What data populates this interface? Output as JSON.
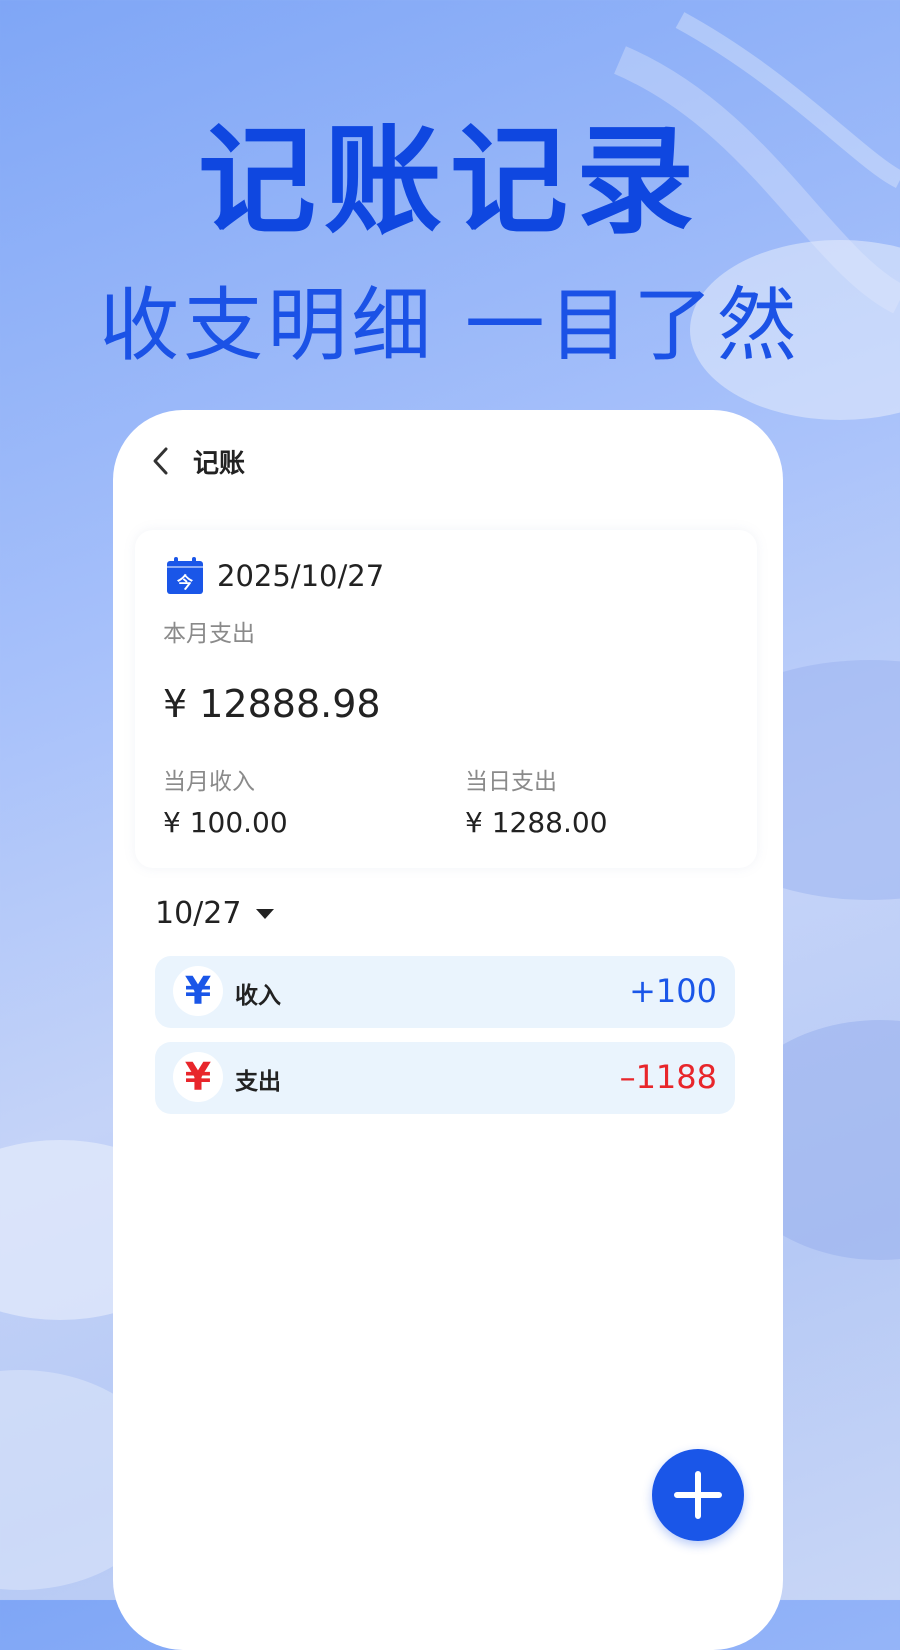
{
  "hero": {
    "title": "记账记录",
    "subtitle": "收支明细 一目了然"
  },
  "nav": {
    "title": "记账"
  },
  "summary": {
    "date": "2025/10/27",
    "calendar_glyph": "今",
    "month_expense_label": "本月支出",
    "month_expense_value": "¥ 12888.98",
    "month_income_label": "当月收入",
    "month_income_value": "¥ 100.00",
    "day_expense_label": "当日支出",
    "day_expense_value": "¥ 1288.00"
  },
  "list": {
    "day": "10/27",
    "entries": [
      {
        "icon": "¥",
        "label": "收入",
        "amount": "+100",
        "color": "#1a56e8"
      },
      {
        "icon": "¥",
        "label": "支出",
        "amount": "–1188",
        "color": "#e8262b"
      }
    ]
  },
  "colors": {
    "accent": "#1a56e8",
    "income": "#1a56e8",
    "expense": "#e8262b",
    "hero_title": "#0f47e0"
  },
  "icons": {
    "back": "chevron-left-icon",
    "calendar": "calendar-icon",
    "dropdown": "caret-down-icon",
    "add": "plus-icon"
  }
}
